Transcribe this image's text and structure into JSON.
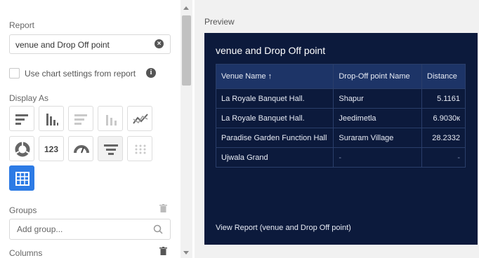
{
  "left_panel": {
    "report_label": "Report",
    "report_value": "venue and Drop Off point",
    "use_chart_settings_label": "Use chart settings from report",
    "display_as_label": "Display As",
    "number_tile_label": "123",
    "groups_label": "Groups",
    "add_group_placeholder": "Add group...",
    "columns_label": "Columns"
  },
  "preview": {
    "label": "Preview",
    "card_title": "venue and Drop Off point",
    "table": {
      "headers": [
        "Venue Name ↑",
        "Drop-Off point Name",
        "Distance"
      ],
      "rows": [
        [
          "La Royale Banquet Hall.",
          "Shapur",
          "5.1161"
        ],
        [
          "La Royale Banquet Hall.",
          "Jeedimetla",
          "6.9030к"
        ],
        [
          "Paradise Garden Function Hall",
          "Suraram Village",
          "28.2332"
        ],
        [
          "Ujwala Grand",
          "-",
          "-"
        ]
      ]
    },
    "view_link": "View Report (venue and Drop Off point)"
  },
  "colors": {
    "card_bg": "#0c1a3c",
    "header_bg": "#1d3467",
    "active_tile": "#2d7be5"
  }
}
